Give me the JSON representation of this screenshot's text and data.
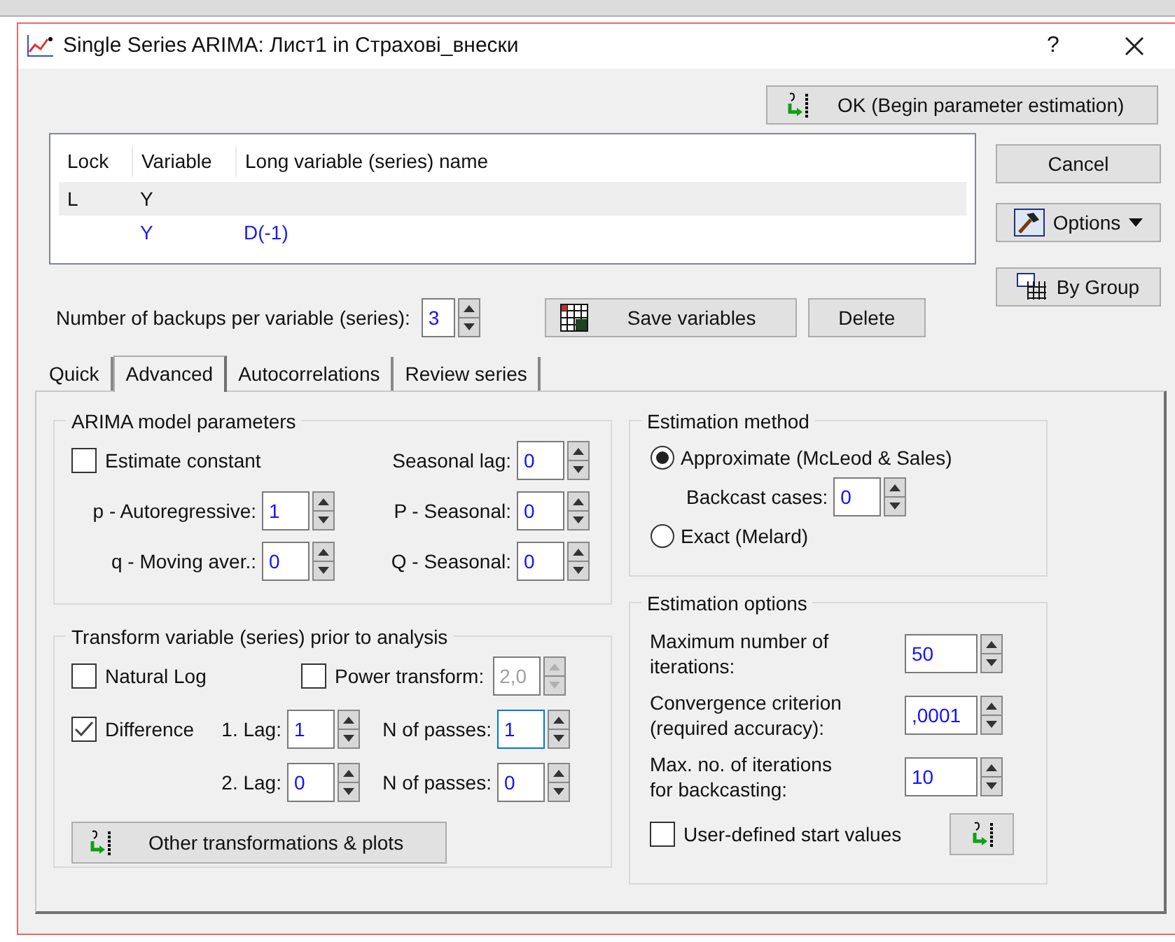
{
  "window": {
    "title": "Single Series ARIMA: Лист1 in Страхові_внески",
    "help": "?"
  },
  "ok_button": "OK (Begin parameter estimation)",
  "side_buttons": [
    {
      "label": "Cancel",
      "kind": "plain"
    },
    {
      "label": "Options",
      "kind": "dropdown"
    },
    {
      "label": "By Group",
      "kind": "group"
    }
  ],
  "variables_table": {
    "columns": [
      "Lock",
      "Variable",
      "Long variable (series) name"
    ],
    "rows": [
      {
        "lock": "L",
        "variable": "Y",
        "selected": true,
        "kind": "original"
      },
      {
        "variable": "Y",
        "long_name": "D(-1)",
        "selected": false,
        "kind": "transformed"
      }
    ]
  },
  "backups": {
    "label": "Number of backups per variable (series):",
    "value": "3"
  },
  "save_button": "Save variables",
  "delete_button": "Delete",
  "tabs": [
    {
      "label": "Quick",
      "selected": false
    },
    {
      "label": "Advanced",
      "selected": true
    },
    {
      "label": "Autocorrelations",
      "selected": false
    },
    {
      "label": "Review series",
      "selected": false
    }
  ],
  "arima": {
    "title": "ARIMA model parameters",
    "estimate_constant": {
      "label": "Estimate constant",
      "checked": false
    },
    "left_fields": [
      {
        "label": "p - Autoregressive:",
        "value": "1"
      },
      {
        "label": "q - Moving aver.:",
        "value": "0"
      }
    ],
    "right_fields": [
      {
        "label": "Seasonal lag:",
        "value": "0"
      },
      {
        "label": "P - Seasonal:",
        "value": "0"
      },
      {
        "label": "Q - Seasonal:",
        "value": "0"
      }
    ]
  },
  "transform": {
    "title": "Transform variable (series) prior to analysis",
    "natural_log": {
      "label": "Natural Log",
      "checked": false
    },
    "power": {
      "label": "Power transform:",
      "checked": false,
      "value": "2,0",
      "disabled": true
    },
    "difference": {
      "label": "Difference",
      "checked": true
    },
    "lags": [
      {
        "lag_label": "1. Lag:",
        "lag_value": "1",
        "passes_label": "N of passes:",
        "passes_value": "1",
        "focused": true
      },
      {
        "lag_label": "2. Lag:",
        "lag_value": "0",
        "passes_label": "N of passes:",
        "passes_value": "0",
        "focused": false
      }
    ],
    "other_button": "Other transformations & plots"
  },
  "estimation_method": {
    "title": "Estimation method",
    "options": [
      {
        "label": "Approximate (McLeod & Sales)",
        "selected": true
      },
      {
        "label": "Exact (Melard)",
        "selected": false
      }
    ],
    "backcast": {
      "label": "Backcast cases:",
      "value": "0"
    }
  },
  "estimation_options": {
    "title": "Estimation options",
    "fields": [
      {
        "label": "Maximum number of iterations:",
        "value": "50"
      },
      {
        "label": "Convergence criterion (required accuracy):",
        "value": ",0001"
      },
      {
        "label": "Max. no. of iterations for backcasting:",
        "value": "10"
      }
    ],
    "user_defined": {
      "label": "User-defined start values",
      "checked": false
    }
  }
}
